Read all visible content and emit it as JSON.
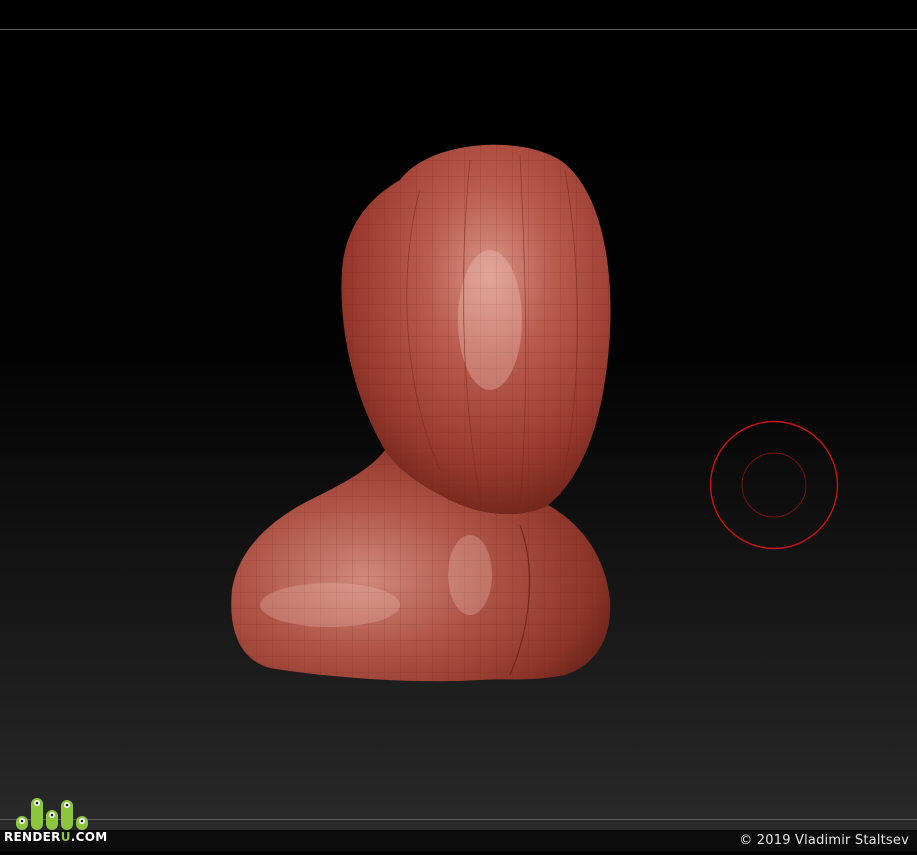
{
  "canvas": {
    "background_top": "#000000",
    "background_bottom": "#2a2a2a",
    "frame_line_color": "#5a5a5a",
    "mesh_color": "#a8463a",
    "brush_cursor_color": "#cc1111"
  },
  "footer": {
    "copyright": "© 2019 Vladimir Staltsev"
  },
  "logo": {
    "text_main_1": "RENDER",
    "text_accent": "U",
    "text_main_2": ".COM",
    "accent_color": "#8cc63f"
  }
}
